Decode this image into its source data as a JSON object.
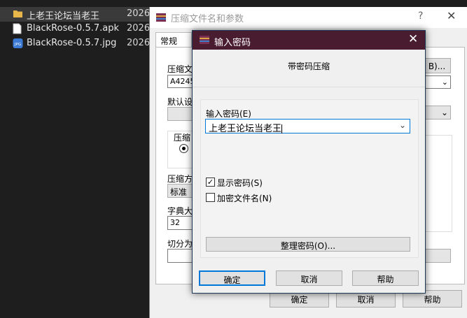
{
  "explorer": {
    "files": [
      {
        "name": "上老王论坛当老王",
        "date": "2026/",
        "icon": "folder-icon"
      },
      {
        "name": "BlackRose-0.5.7.apk",
        "date": "2026/",
        "icon": "file-icon"
      },
      {
        "name": "BlackRose-0.5.7.jpg",
        "date": "2026/",
        "icon": "image-icon",
        "icon_text": "JPG"
      }
    ]
  },
  "archive_dialog": {
    "title": "压缩文件名和参数",
    "help_glyph": "?",
    "close_glyph": "✕",
    "tab_general": "常规",
    "archive_name_label": "压缩文",
    "archive_name_value": "A4245",
    "browse_label": "B)...",
    "default_profile_label": "默认设",
    "archive_format_label": "压缩",
    "method_label": "压缩方",
    "method_value": "标准",
    "dict_label": "字典大",
    "dict_value": "32",
    "split_label": "切分为",
    "ok": "确定",
    "cancel": "取消",
    "help": "帮助"
  },
  "password_dialog": {
    "title": "输入密码",
    "subtitle": "带密码压缩",
    "enter_label": "输入密码(E)",
    "password_value": "上老王论坛当老王",
    "show_password": "显示密码(S)",
    "show_password_checked": true,
    "encrypt_names": "加密文件名(N)",
    "encrypt_names_checked": false,
    "organize": "整理密码(O)...",
    "ok": "确定",
    "cancel": "取消",
    "help": "帮助",
    "close_glyph": "✕"
  },
  "colors": {
    "titlebar_active": "#4a1c2f",
    "accent": "#0078d7",
    "explorer_bg": "#1e1e1e"
  }
}
